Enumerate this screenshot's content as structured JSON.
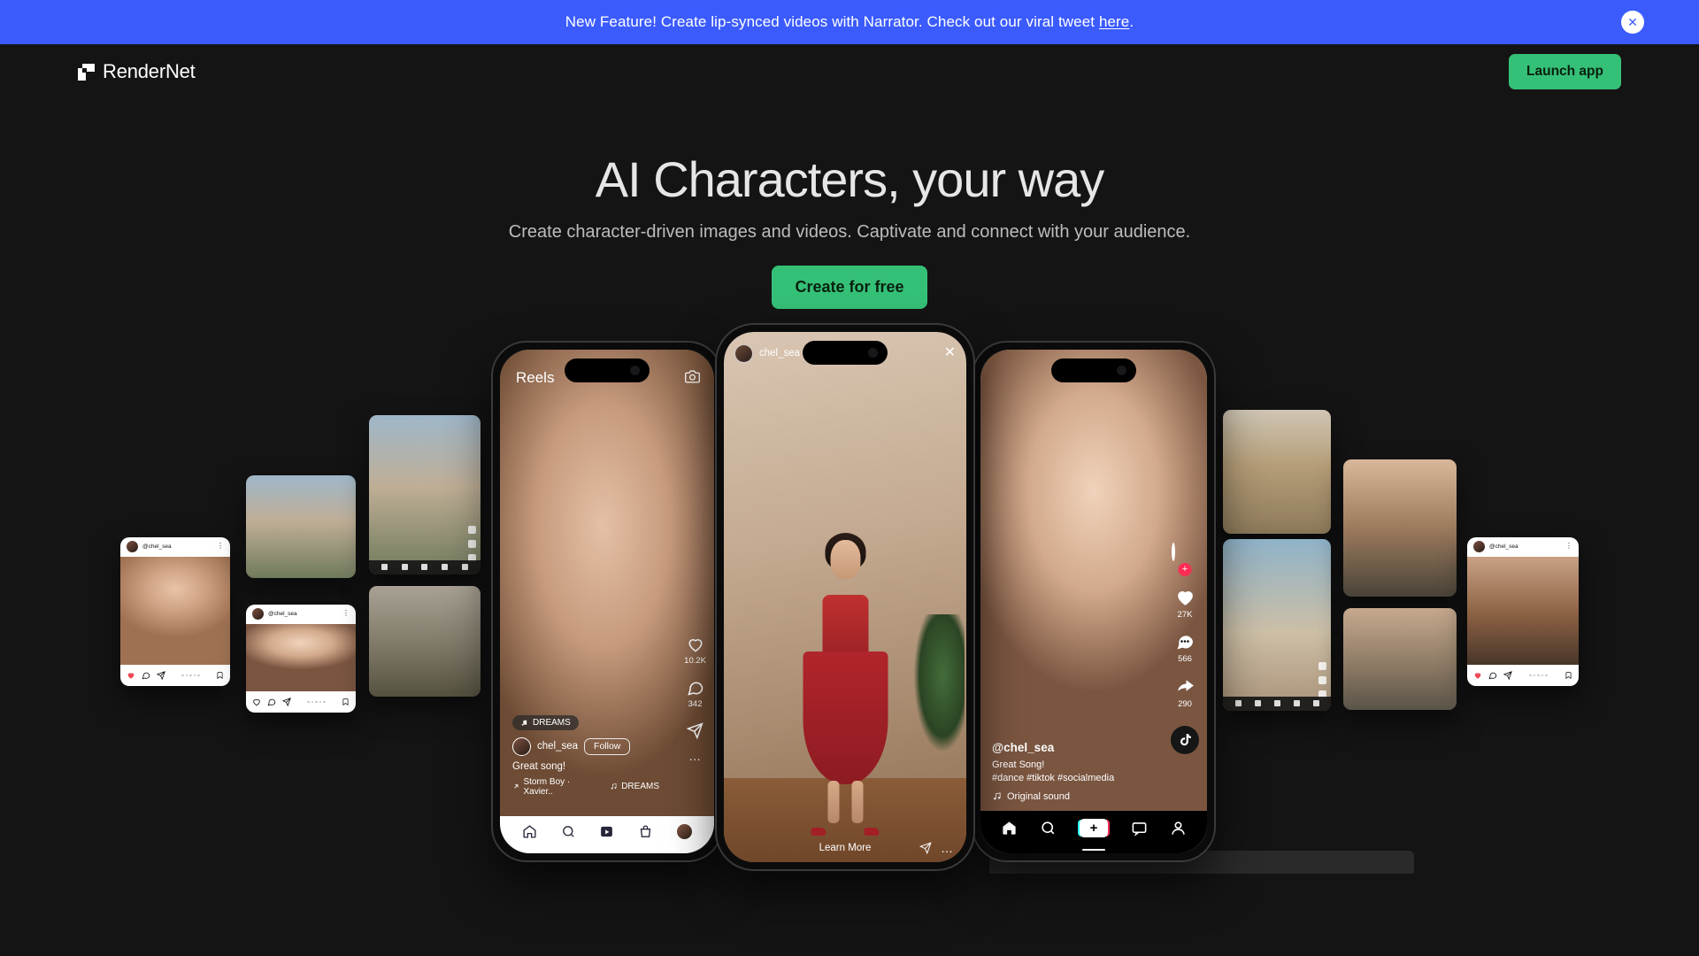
{
  "banner": {
    "text_before": "New Feature! Create lip-synced videos with Narrator. Check out our viral tweet ",
    "link_label": "here",
    "text_after": ".",
    "close_label": "✕",
    "bg_color": "#3b5bfd"
  },
  "header": {
    "logo_text": "RenderNet",
    "logo_icon": "rendernet-square-icon",
    "launch_label": "Launch app",
    "accent_color": "#35c077"
  },
  "hero": {
    "headline": "AI Characters, your way",
    "subheadline": "Create character-driven images and videos. Captivate and connect with your audience.",
    "cta_label": "Create for free"
  },
  "showcase": {
    "center_phone": {
      "app": "instagram-story",
      "username": "chel_sea",
      "close_icon": "close-icon",
      "learn_more_label": "Learn More",
      "send_icon": "send-icon",
      "more_icon": "more-dots-icon"
    },
    "left_phone": {
      "app": "instagram-reels",
      "title": "Reels",
      "camera_icon": "camera-icon",
      "audio_chip": "DREAMS",
      "username": "chel_sea",
      "follow_label": "Follow",
      "caption": "Great song!",
      "audio_track": "Storm Boy · Xavier..",
      "audio_label": "DREAMS",
      "rail": [
        {
          "icon": "heart-icon",
          "count": "10.2K"
        },
        {
          "icon": "comment-icon",
          "count": "342"
        },
        {
          "icon": "send-icon",
          "count": ""
        },
        {
          "icon": "more-dots-icon",
          "count": ""
        }
      ],
      "navbar": [
        "home-icon",
        "search-icon",
        "reels-icon",
        "shop-icon",
        "profile-avatar"
      ]
    },
    "right_phone": {
      "app": "tiktok",
      "username": "@chel_sea",
      "caption_line1": "Great Song!",
      "caption_line2": "#dance #tiktok #socialmedia",
      "sound_label": "Original sound",
      "music_icon": "music-note-icon",
      "rail": [
        {
          "icon": "profile-avatar-follow",
          "count": ""
        },
        {
          "icon": "heart-icon",
          "count": "27K"
        },
        {
          "icon": "comment-icon",
          "count": "566"
        },
        {
          "icon": "share-icon",
          "count": "290"
        },
        {
          "icon": "tiktok-note-icon",
          "count": ""
        }
      ],
      "navbar": [
        "home-icon",
        "search-icon",
        "create-icon",
        "inbox-icon",
        "profile-icon"
      ],
      "create_label": "+"
    },
    "mini_cards": [
      {
        "id": "m1",
        "type": "instagram-post",
        "username": "@chel_sea",
        "scene": "mirror-selfie-black-top"
      },
      {
        "id": "m2",
        "type": "photo",
        "username": "",
        "scene": "outdoor-floral-dress"
      },
      {
        "id": "m3",
        "type": "instagram-post",
        "username": "@chel_sea",
        "scene": "eating-pizza-white-top"
      },
      {
        "id": "m4",
        "type": "photo",
        "username": "",
        "scene": "street-white-shirt-jeans"
      },
      {
        "id": "m5",
        "type": "photo",
        "username": "",
        "scene": "sitting-steps-black-top"
      },
      {
        "id": "m6",
        "type": "photo",
        "username": "",
        "scene": "yellow-top-street"
      },
      {
        "id": "m7",
        "type": "photo",
        "username": "",
        "scene": "beach-blue-dress"
      },
      {
        "id": "m8",
        "type": "photo",
        "username": "",
        "scene": "dark-green-top-portrait"
      },
      {
        "id": "m9",
        "type": "photo",
        "username": "",
        "scene": "denim-shirt-portrait"
      },
      {
        "id": "m10",
        "type": "instagram-post",
        "username": "@chel_sea",
        "scene": "cafe-burger"
      }
    ]
  }
}
